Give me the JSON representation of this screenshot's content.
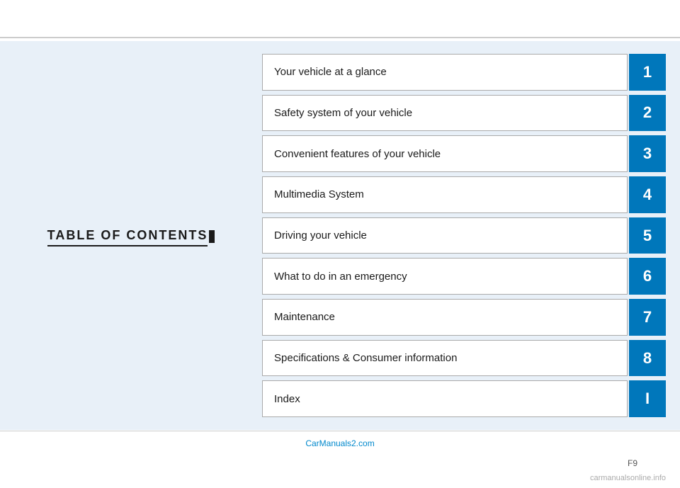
{
  "page": {
    "top_line": true,
    "bottom_line": true
  },
  "left_panel": {
    "title": "TABLE OF CONTENTS"
  },
  "toc": {
    "items": [
      {
        "label": "Your vehicle at a glance",
        "number": "1"
      },
      {
        "label": "Safety system of your vehicle",
        "number": "2"
      },
      {
        "label": "Convenient features of your vehicle",
        "number": "3"
      },
      {
        "label": "Multimedia System",
        "number": "4"
      },
      {
        "label": "Driving your vehicle",
        "number": "5"
      },
      {
        "label": "What to do in an emergency",
        "number": "6"
      },
      {
        "label": "Maintenance",
        "number": "7"
      },
      {
        "label": "Specifications & Consumer information",
        "number": "8"
      },
      {
        "label": "Index",
        "number": "I"
      }
    ]
  },
  "footer": {
    "watermark": "CarManuals2.com",
    "page_number": "F9",
    "bottom_site": "carmanualsonline.info"
  },
  "colors": {
    "accent": "#0077bb",
    "background_light": "#e8f0f8",
    "border": "#aaaaaa"
  }
}
